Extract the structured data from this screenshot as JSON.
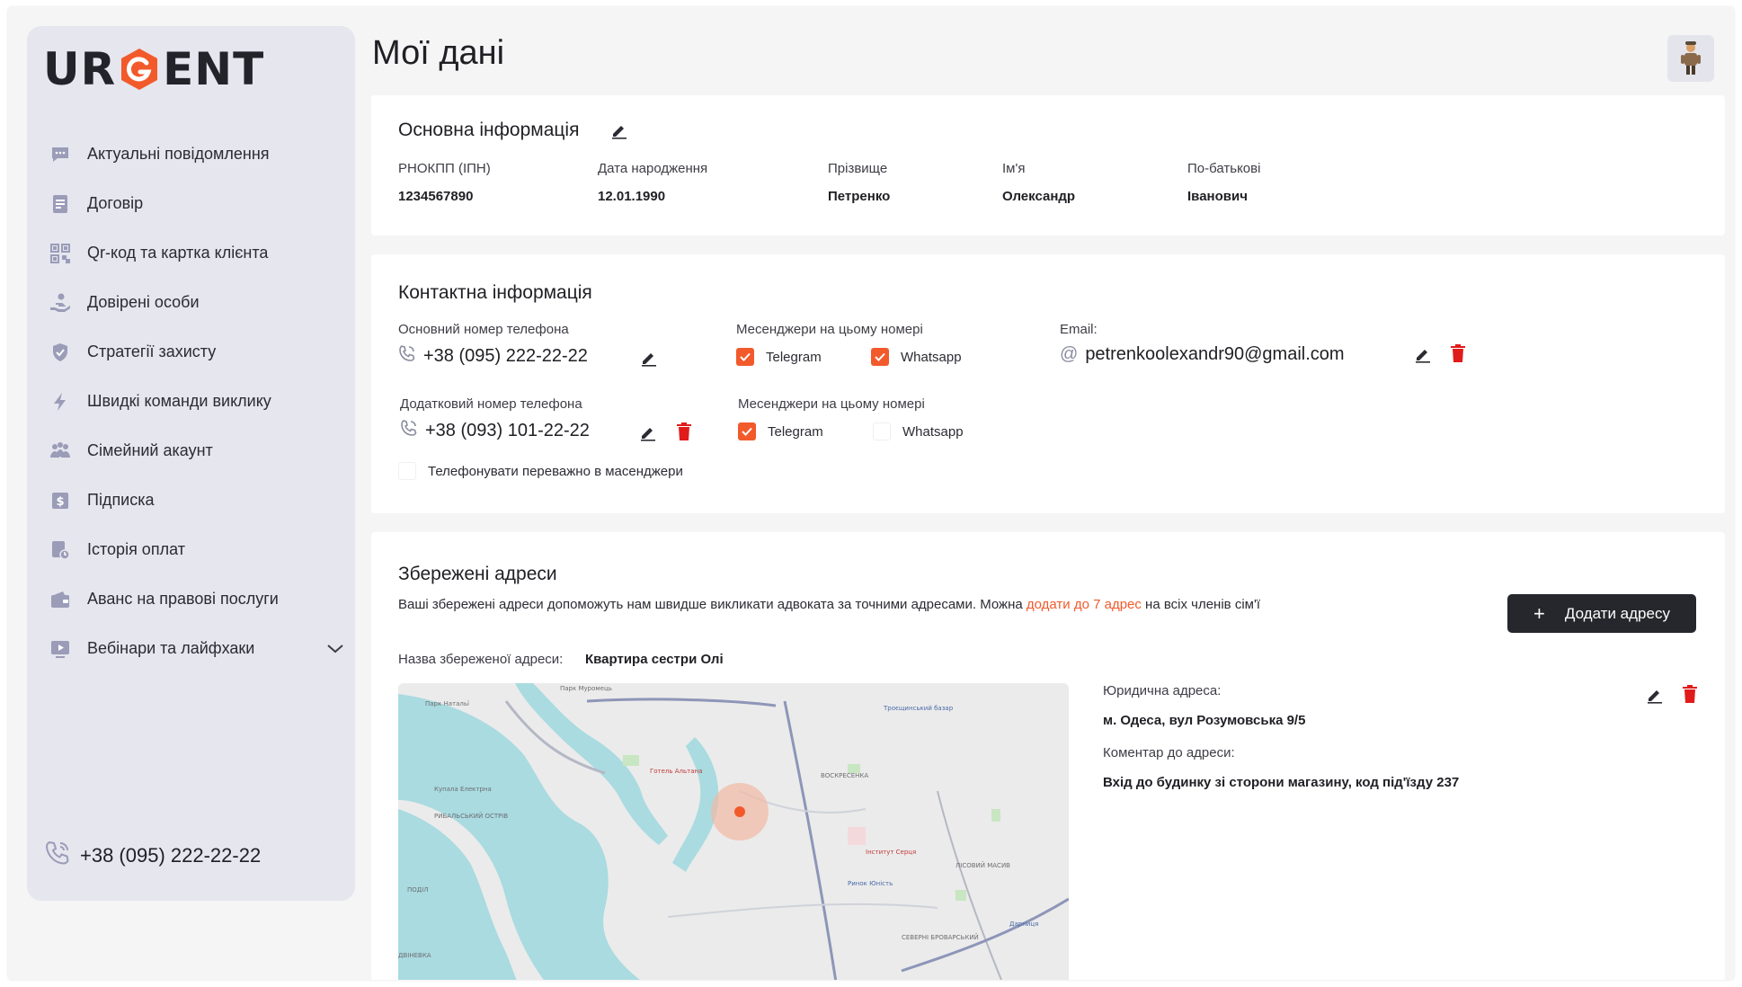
{
  "brand": {
    "left": "UR",
    "right": "ENT"
  },
  "sidebar": {
    "items": [
      {
        "label": "Актуальні повідомлення",
        "icon": "chat-icon"
      },
      {
        "label": "Договір",
        "icon": "document-icon"
      },
      {
        "label": "Qr-код та картка клієнта",
        "icon": "qr-icon"
      },
      {
        "label": "Довірені особи",
        "icon": "trusted-hand-icon"
      },
      {
        "label": "Стратегії захисту",
        "icon": "shield-icon"
      },
      {
        "label": "Швидкі команди виклику",
        "icon": "lightning-icon"
      },
      {
        "label": "Сімейний акаунт",
        "icon": "family-icon"
      },
      {
        "label": "Підписка",
        "icon": "subscription-icon"
      },
      {
        "label": "Історія оплат",
        "icon": "payment-history-icon"
      },
      {
        "label": "Аванс на правові послуги",
        "icon": "wallet-icon"
      },
      {
        "label": "Вебінари та лайфхаки",
        "icon": "video-icon"
      }
    ],
    "phone": "+38 (095) 222-22-22"
  },
  "header": {
    "title": "Мої дані"
  },
  "basic": {
    "title": "Основна інформація",
    "fields": [
      {
        "label": "РНОКПП (ІПН)",
        "value": "1234567890"
      },
      {
        "label": "Дата народження",
        "value": "12.01.1990"
      },
      {
        "label": "Прізвище",
        "value": "Петренко"
      },
      {
        "label": "Ім'я",
        "value": "Олександр"
      },
      {
        "label": "По-батькові",
        "value": "Іванович"
      }
    ]
  },
  "contact": {
    "title": "Контактна інформація",
    "primary_label": "Основний номер телефона",
    "primary_phone": "+38 (095) 222-22-22",
    "messengers_label": "Месенджери на цьому номері",
    "primary_messengers": [
      {
        "name": "Telegram",
        "checked": true
      },
      {
        "name": "Whatsapp",
        "checked": true
      }
    ],
    "email_label": "Email:",
    "email": "petrenkoolexandr90@gmail.com",
    "secondary_label": "Додатковий номер телефона",
    "secondary_phone": "+38 (093) 101-22-22",
    "secondary_messengers": [
      {
        "name": "Telegram",
        "checked": true
      },
      {
        "name": "Whatsapp",
        "checked": false
      }
    ],
    "prefer_messengers": {
      "label": "Телефонувати переважно в масенджери",
      "checked": false
    }
  },
  "addresses": {
    "title": "Збережені адреси",
    "desc_before": "Ваші збережені адреси допоможуть нам швидше викликати адвоката за точними адресами. Можна ",
    "desc_accent": "додати до 7 адрес",
    "desc_after": " на всіх членів сім'ї",
    "add_label": "Додати адресу",
    "name_label": "Назва збереженої адреси:",
    "name_value": "Квартира сестри Олі",
    "legal_label": "Юридична адреса:",
    "legal_value": "м. Одеса, вул Розумовська 9/5",
    "comment_label": "Коментар до адреси:",
    "comment_value": "Вхід до будинку зі сторони магазину, код під'їзду 237"
  },
  "colors": {
    "accent": "#f25a2b",
    "danger": "#e01b1b",
    "sidebar": "#e5e6ee",
    "dark_button": "#26272d"
  }
}
